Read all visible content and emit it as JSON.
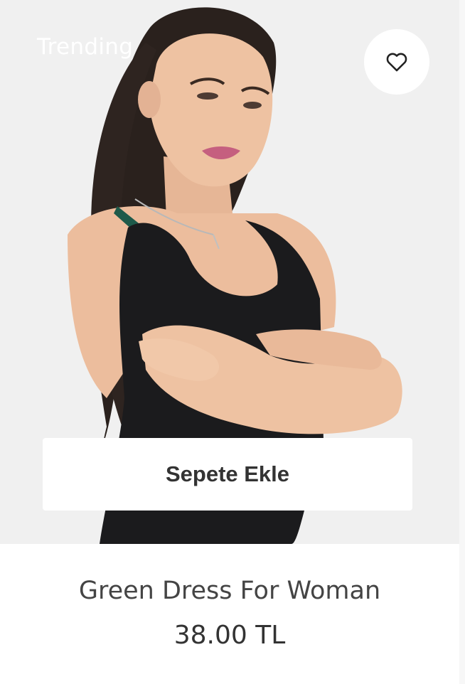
{
  "product": {
    "badge": "Trending",
    "wishlist_icon": "heart-outline-icon",
    "add_to_cart_label": "Sepete Ekle",
    "name": "Green Dress For Woman",
    "price": "38.00 TL"
  },
  "colors": {
    "image_background": "#f0f0f0",
    "card_background": "#ffffff",
    "text": "#444444",
    "button_text": "#333333"
  }
}
